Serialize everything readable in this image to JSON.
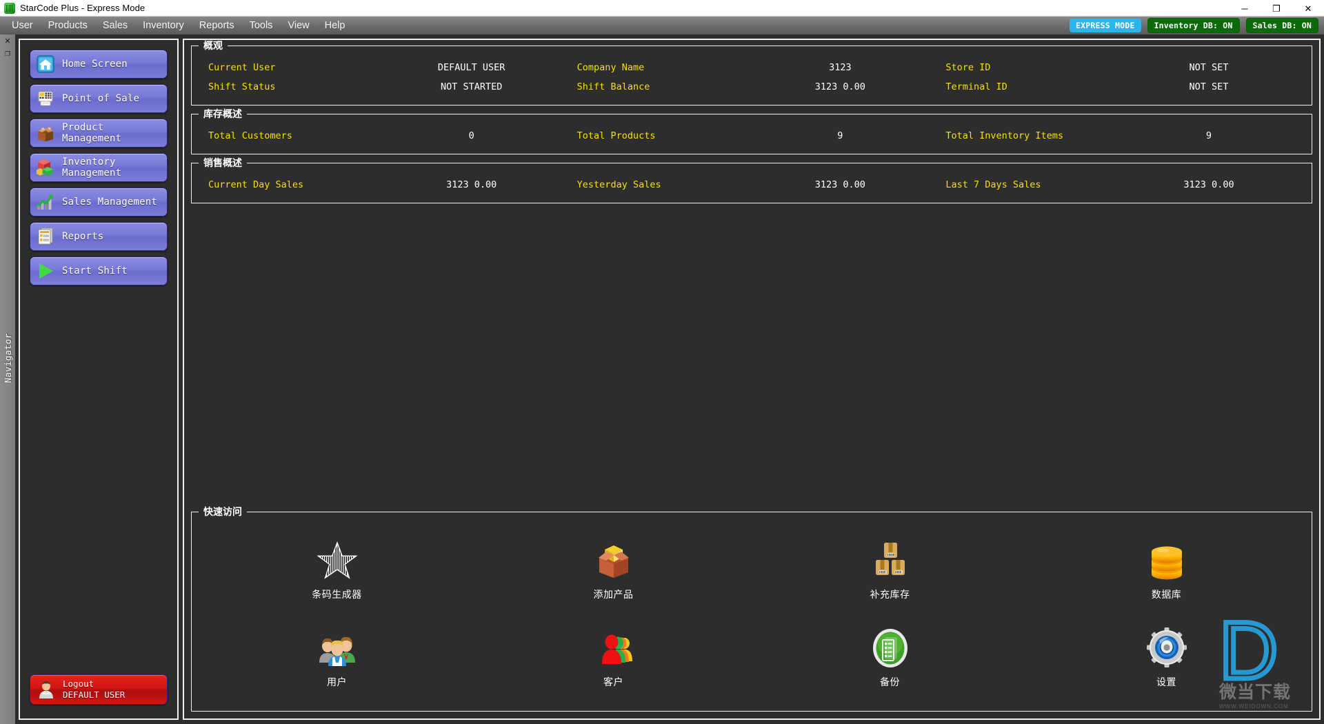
{
  "window": {
    "title": "StarCode Plus - Express Mode",
    "app_icon": "starcode-icon",
    "minimize": "─",
    "maximize": "❐",
    "close": "✕"
  },
  "menubar": {
    "items": [
      {
        "label": "User"
      },
      {
        "label": "Products"
      },
      {
        "label": "Sales"
      },
      {
        "label": "Inventory"
      },
      {
        "label": "Reports"
      },
      {
        "label": "Tools"
      },
      {
        "label": "View"
      },
      {
        "label": "Help"
      }
    ],
    "badges": [
      {
        "label": "EXPRESS MODE",
        "color": "#29b6ec",
        "kind": "express"
      },
      {
        "label": "Inventory DB: ON",
        "color": "#0b6b0b",
        "kind": "db"
      },
      {
        "label": "Sales DB: ON",
        "color": "#0b6b0b",
        "kind": "db"
      }
    ]
  },
  "dock": {
    "close_icon": "✕",
    "float_icon": "❐",
    "vertical_label": "Navigator"
  },
  "navigator": {
    "items": [
      {
        "label": "Home Screen",
        "icon": "home-icon"
      },
      {
        "label": "Point of Sale",
        "icon": "point-of-sale-icon"
      },
      {
        "label": "Product Management",
        "icon": "product-box-icon"
      },
      {
        "label": "Inventory Management",
        "icon": "inventory-blocks-icon"
      },
      {
        "label": "Sales Management",
        "icon": "sales-chart-icon"
      },
      {
        "label": "Reports",
        "icon": "reports-icon"
      },
      {
        "label": "Start Shift",
        "icon": "play-icon"
      }
    ],
    "logout": {
      "line1": "Logout",
      "line2": "DEFAULT USER",
      "icon": "user-avatar-icon"
    }
  },
  "overview": {
    "title": "概观",
    "rows": [
      [
        {
          "key": "Current User",
          "value": "DEFAULT USER"
        },
        {
          "key": "Company Name",
          "value": "3123"
        },
        {
          "key": "Store ID",
          "value": "NOT SET"
        }
      ],
      [
        {
          "key": "Shift Status",
          "value": "NOT STARTED"
        },
        {
          "key": "Shift Balance",
          "value": "3123 0.00"
        },
        {
          "key": "Terminal ID",
          "value": "NOT SET"
        }
      ]
    ]
  },
  "inventory_overview": {
    "title": "库存概述",
    "rows": [
      [
        {
          "key": "Total Customers",
          "value": "0"
        },
        {
          "key": "Total Products",
          "value": "9"
        },
        {
          "key": "Total Inventory Items",
          "value": "9"
        }
      ]
    ]
  },
  "sales_overview": {
    "title": "销售概述",
    "rows": [
      [
        {
          "key": "Current Day Sales",
          "value": "3123 0.00"
        },
        {
          "key": "Yesterday Sales",
          "value": "3123 0.00"
        },
        {
          "key": "Last 7 Days Sales",
          "value": "3123 0.00"
        }
      ]
    ]
  },
  "quick_access": {
    "title": "快速访问",
    "items": [
      {
        "label": "条码生成器",
        "icon": "barcode-star-icon"
      },
      {
        "label": "添加产品",
        "icon": "add-product-box-icon"
      },
      {
        "label": "补充库存",
        "icon": "restock-boxes-icon"
      },
      {
        "label": "数据库",
        "icon": "database-icon"
      },
      {
        "label": "用户",
        "icon": "users-group-icon"
      },
      {
        "label": "客户",
        "icon": "customers-icon"
      },
      {
        "label": "备份",
        "icon": "backup-icon"
      },
      {
        "label": "设置",
        "icon": "gear-settings-icon"
      }
    ]
  },
  "watermark": {
    "logo": "D",
    "text": "微当下载",
    "url": "WWW.WEIDOWN.COM"
  },
  "theme": {
    "background": "#2d2d2d",
    "label_color": "#f5e000",
    "value_color": "#ffffff",
    "accent": "#7b7cd8"
  }
}
